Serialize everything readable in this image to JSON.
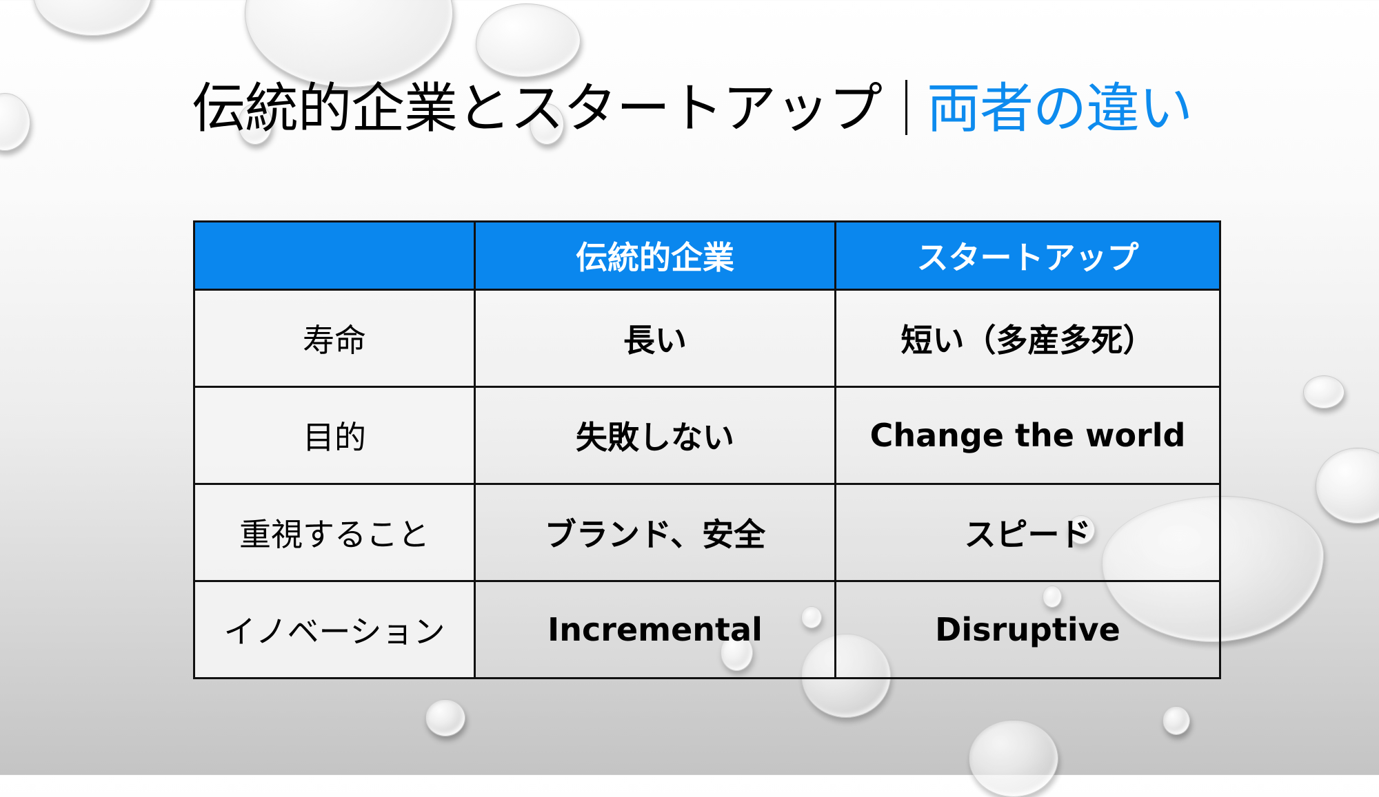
{
  "slide": {
    "title": {
      "main": "伝統的企業とスタートアップ",
      "separator": "｜",
      "accent": "両者の違い",
      "accent_color": "#0d8bee"
    },
    "table": {
      "header_color": "#0a87ee",
      "headers": [
        "",
        "伝統的企業",
        "スタートアップ"
      ],
      "rows": [
        {
          "label": "寿命",
          "traditional": "長い",
          "startup": "短い（多産多死）"
        },
        {
          "label": "目的",
          "traditional": "失敗しない",
          "startup": "Change the world"
        },
        {
          "label": "重視すること",
          "traditional": "ブランド、安全",
          "startup": "スピード"
        },
        {
          "label": "イノベーション",
          "traditional": "Incremental",
          "startup": "Disruptive"
        }
      ]
    },
    "background": {
      "theme": "water-droplets",
      "decorations": "water-drop"
    }
  }
}
